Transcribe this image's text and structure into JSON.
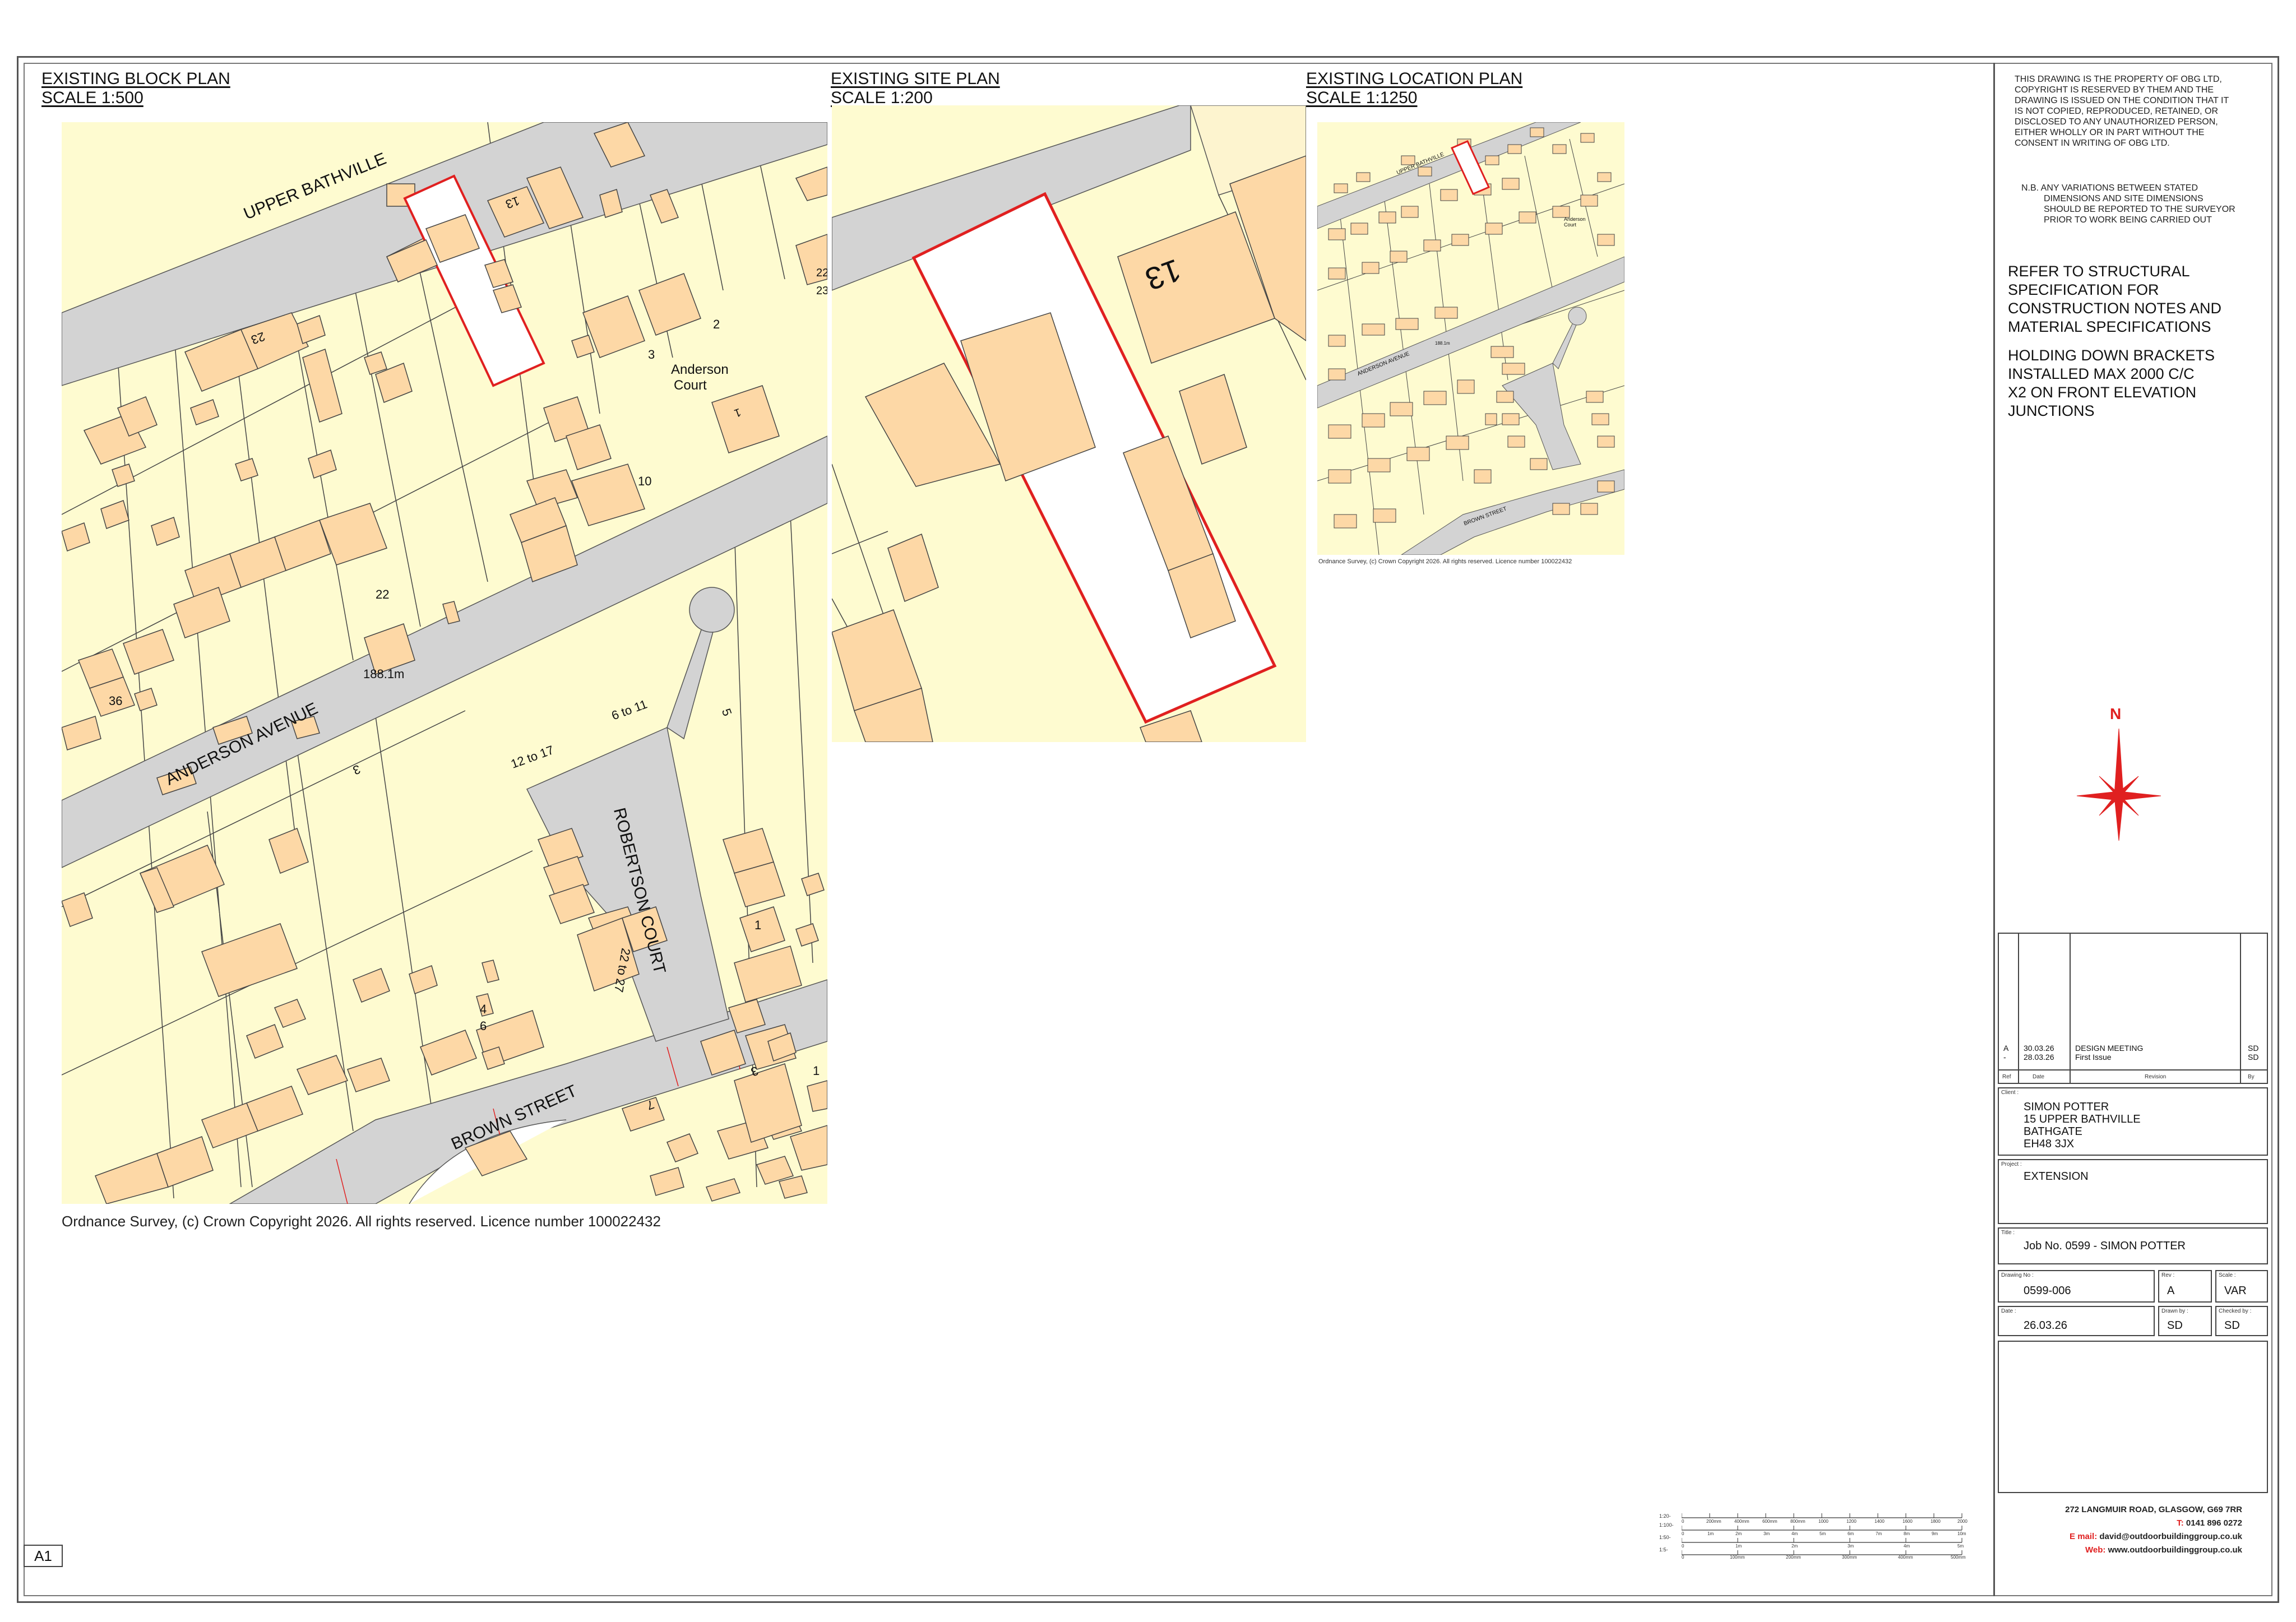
{
  "plans": {
    "block": {
      "title": "EXISTING BLOCK PLAN",
      "scale": "SCALE 1:500",
      "labels": {
        "upper_bathville": "UPPER BATHVILLE",
        "anderson_avenue": "ANDERSON AVENUE",
        "robertson_court": "ROBERTSON COURT",
        "brown_street": "BROWN STREET",
        "anderson_court": "Anderson",
        "anderson_court2": "Court",
        "dim": "188.1m",
        "n13": "13",
        "n23": "23",
        "n22": "22",
        "n36": "36",
        "n3": "3",
        "n2": "2",
        "n1a": "1",
        "n10": "10",
        "n5": "5",
        "n6to11": "6 to 11",
        "n12to17": "12 to 17",
        "n1b": "1",
        "n3b": "3",
        "n1c": "1",
        "n22to27": "22 to 27",
        "n4": "4",
        "n6": "6",
        "n7": "7",
        "n3c": "3",
        "n22b": "22",
        "n23b": "23"
      },
      "copyright": "Ordnance Survey, (c) Crown Copyright 2026. All rights reserved. Licence number 100022432"
    },
    "site": {
      "title": "EXISTING SITE PLAN",
      "scale": "SCALE 1:200",
      "labels": {
        "n13": "13"
      }
    },
    "location": {
      "title": "EXISTING LOCATION PLAN",
      "scale": "SCALE 1:1250",
      "labels": {
        "upper_bathville": "UPPER BATHVILLE",
        "anderson_avenue": "ANDERSON AVENUE",
        "brown_street": "BROWN STREET",
        "anderson_court": "Anderson Court",
        "dim": "188.1m"
      },
      "copyright": "Ordnance Survey, (c) Crown Copyright 2026. All rights reserved. Licence number 100022432"
    }
  },
  "notes": {
    "copyright_lines": [
      "THIS DRAWING IS THE PROPERTY OF OBG LTD,",
      "COPYRIGHT IS RESERVED BY THEM AND THE",
      "DRAWING IS ISSUED ON THE CONDITION THAT IT",
      "IS NOT COPIED, REPRODUCED, RETAINED, OR",
      "DISCLOSED TO ANY UNAUTHORIZED  PERSON,",
      "EITHER WHOLLY OR IN PART WITHOUT THE",
      "CONSENT IN WRITING OF OBG LTD."
    ],
    "nb_lines": [
      "N.B. ANY VARIATIONS BETWEEN STATED",
      "DIMENSIONS AND SITE DIMENSIONS",
      "SHOULD BE REPORTED TO THE SURVEYOR",
      "PRIOR TO WORK BEING CARRIED OUT"
    ],
    "spec_lines": [
      "REFER TO STRUCTURAL",
      "SPECIFICATION FOR",
      "CONSTRUCTION NOTES AND",
      "MATERIAL SPECIFICATIONS"
    ],
    "bracket_lines": [
      "HOLDING DOWN BRACKETS",
      "INSTALLED MAX 2000 C/C",
      "X2 ON FRONT ELEVATION",
      "JUNCTIONS"
    ],
    "north": "N"
  },
  "revisions": {
    "headers": {
      "ref": "Ref",
      "date": "Date",
      "revision": "Revision",
      "by": "By"
    },
    "rows": [
      {
        "ref": "A",
        "date": "30.03.26",
        "revision": "DESIGN MEETING",
        "by": "SD"
      },
      {
        "ref": "-",
        "date": "28.03.26",
        "revision": "First Issue",
        "by": "SD"
      }
    ]
  },
  "title_block": {
    "client_label": "Client :",
    "client_lines": [
      "SIMON POTTER",
      "15 UPPER BATHVILLE",
      "BATHGATE",
      "EH48 3JX"
    ],
    "project_label": "Project :",
    "project": "EXTENSION",
    "title_label": "Title :",
    "title": "Job No. 0599 - SIMON POTTER",
    "drawing_no_label": "Drawing No :",
    "drawing_no": "0599-006",
    "rev_label": "Rev :",
    "rev": "A",
    "scale_label": "Scale :",
    "scale": "VAR",
    "date_label": "Date :",
    "date": "26.03.26",
    "drawn_label": "Drawn by :",
    "drawn": "SD",
    "checked_label": "Checked by :",
    "checked": "SD"
  },
  "company": {
    "address": "272 LANGMUIR ROAD, GLASGOW, G69 7RR",
    "tel_label": "T:",
    "tel": "0141 896 0272",
    "email_label": "E mail:",
    "email": "david@outdoorbuildinggroup.co.uk",
    "web_label": "Web:",
    "web": "www.outdoorbuildinggroup.co.uk"
  },
  "scale_bar": {
    "rows": [
      "1:20-",
      "1:100-",
      "1:50-",
      "1:5-"
    ],
    "ticks_top": [
      "0",
      "200mm",
      "400mm",
      "600mm",
      "800mm",
      "1000",
      "1200",
      "1400",
      "1600",
      "1800",
      "2000"
    ],
    "ticks_mid": [
      "0",
      "1m",
      "2m",
      "3m",
      "4m",
      "5m",
      "6m",
      "7m",
      "8m",
      "9m",
      "10m"
    ],
    "ticks_50": [
      "0",
      "1m",
      "2m",
      "3m",
      "4m",
      "5m"
    ],
    "ticks_bottom": [
      "0",
      "100mm",
      "200mm",
      "300mm",
      "400mm",
      "500mm"
    ]
  },
  "sheet_size": "A1",
  "colors": {
    "map_bg": "#fefbd0",
    "building": "#fdd8a6",
    "road": "#d3d3d3",
    "boundary": "#e02020"
  }
}
